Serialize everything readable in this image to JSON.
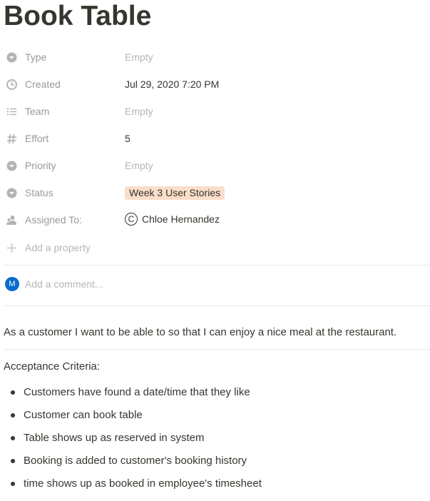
{
  "page": {
    "title": "Book Table"
  },
  "properties": [
    {
      "label": "Type",
      "value": "Empty",
      "icon": "select-icon"
    },
    {
      "label": "Created",
      "value": "Jul 29, 2020 7:20 PM",
      "icon": "clock-icon"
    },
    {
      "label": "Team",
      "value": "Empty",
      "icon": "list-icon"
    },
    {
      "label": "Effort",
      "value": "5",
      "icon": "number-icon"
    },
    {
      "label": "Priority",
      "value": "Empty",
      "icon": "select-icon"
    },
    {
      "label": "Status",
      "value": "Week 3 User Stories",
      "icon": "select-icon",
      "tag_color": "#fadec9"
    },
    {
      "label": "Assigned To:",
      "value": "Chloe Hernandez",
      "avatar_letter": "C",
      "icon": "person-icon"
    }
  ],
  "add_property": {
    "label": "Add a property",
    "icon": "plus-icon"
  },
  "comment": {
    "avatar_letter": "M",
    "avatar_color": "#0b6bcb",
    "placeholder": "Add a comment..."
  },
  "content": {
    "story": "As a customer I want to be able to  so that I can enjoy a nice meal at the restaurant.",
    "criteria_heading": "Acceptance Criteria:",
    "criteria": [
      "Customers have found a date/time that they like",
      "Customer can book table",
      "Table shows up as reserved in system",
      "Booking is added to customer's booking history",
      "time shows up as booked in employee's timesheet"
    ]
  }
}
